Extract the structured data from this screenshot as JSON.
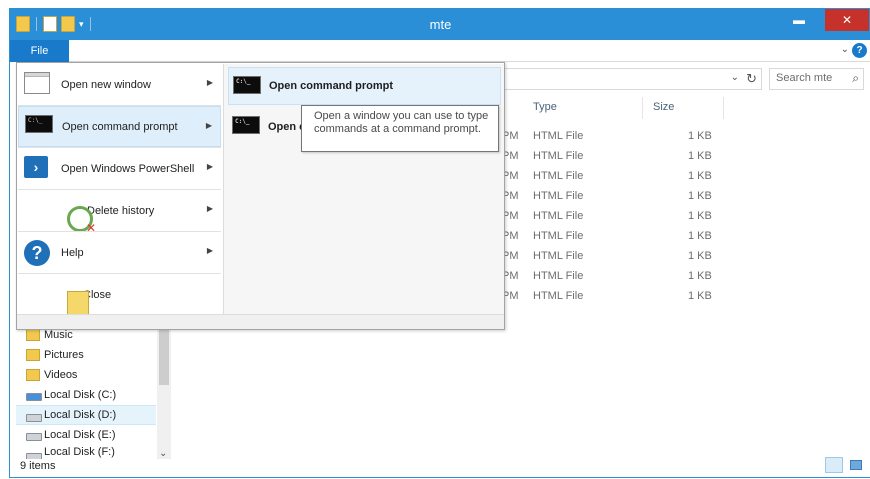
{
  "window": {
    "title": "mte",
    "minimize_glyph": "▬",
    "maximize_glyph": "▫",
    "close_glyph": "✕"
  },
  "colors": {
    "titlebar": "#2b8fd8",
    "file_tab": "#1979ca",
    "close_button": "#c7312b",
    "highlight": "#deeefb"
  },
  "ribbon": {
    "file_tab": "File"
  },
  "search": {
    "placeholder": "Search mte"
  },
  "columns": {
    "type": "Type",
    "size": "Size"
  },
  "files": [
    {
      "date": "PM",
      "type": "HTML File",
      "size": "1 KB"
    },
    {
      "date": "PM",
      "type": "HTML File",
      "size": "1 KB"
    },
    {
      "date": "PM",
      "type": "HTML File",
      "size": "1 KB"
    },
    {
      "date": "PM",
      "type": "HTML File",
      "size": "1 KB"
    },
    {
      "date": "PM",
      "type": "HTML File",
      "size": "1 KB"
    },
    {
      "date": "PM",
      "type": "HTML File",
      "size": "1 KB"
    },
    {
      "date": "PM",
      "type": "HTML File",
      "size": "1 KB"
    },
    {
      "date": "PM",
      "type": "HTML File",
      "size": "1 KB"
    },
    {
      "date": "PM",
      "type": "HTML File",
      "size": "1 KB"
    }
  ],
  "nav": {
    "items": [
      {
        "label": "Music",
        "icon": "music-folder-icon"
      },
      {
        "label": "Pictures",
        "icon": "pictures-folder-icon"
      },
      {
        "label": "Videos",
        "icon": "videos-folder-icon"
      },
      {
        "label": "Local Disk (C:)",
        "icon": "system-disk-icon"
      },
      {
        "label": "Local Disk (D:)",
        "icon": "disk-icon"
      },
      {
        "label": "Local Disk (E:)",
        "icon": "disk-icon"
      },
      {
        "label": "Local Disk (F:)",
        "icon": "disk-icon"
      }
    ]
  },
  "status": {
    "items": "9 items"
  },
  "file_menu": {
    "items": [
      {
        "label": "Open new window",
        "icon": "new-window-icon",
        "has_submenu": true
      },
      {
        "label": "Open command prompt",
        "icon": "command-prompt-icon",
        "has_submenu": true
      },
      {
        "label": "Open Windows PowerShell",
        "icon": "powershell-icon",
        "has_submenu": true
      },
      {
        "label": "Delete history",
        "icon": "delete-history-icon",
        "has_submenu": true
      },
      {
        "label": "Help",
        "icon": "help-icon",
        "has_submenu": true
      },
      {
        "label": "Close",
        "icon": "close-folder-icon",
        "has_submenu": false
      }
    ],
    "submenu": [
      {
        "label": "Open command prompt",
        "icon": "command-prompt-icon"
      },
      {
        "label": "Open c",
        "icon": "admin-command-prompt-icon"
      }
    ],
    "cmd_glyph": "C:\\_"
  },
  "tooltip": {
    "text": "Open a window you can use to type commands at a command prompt."
  }
}
